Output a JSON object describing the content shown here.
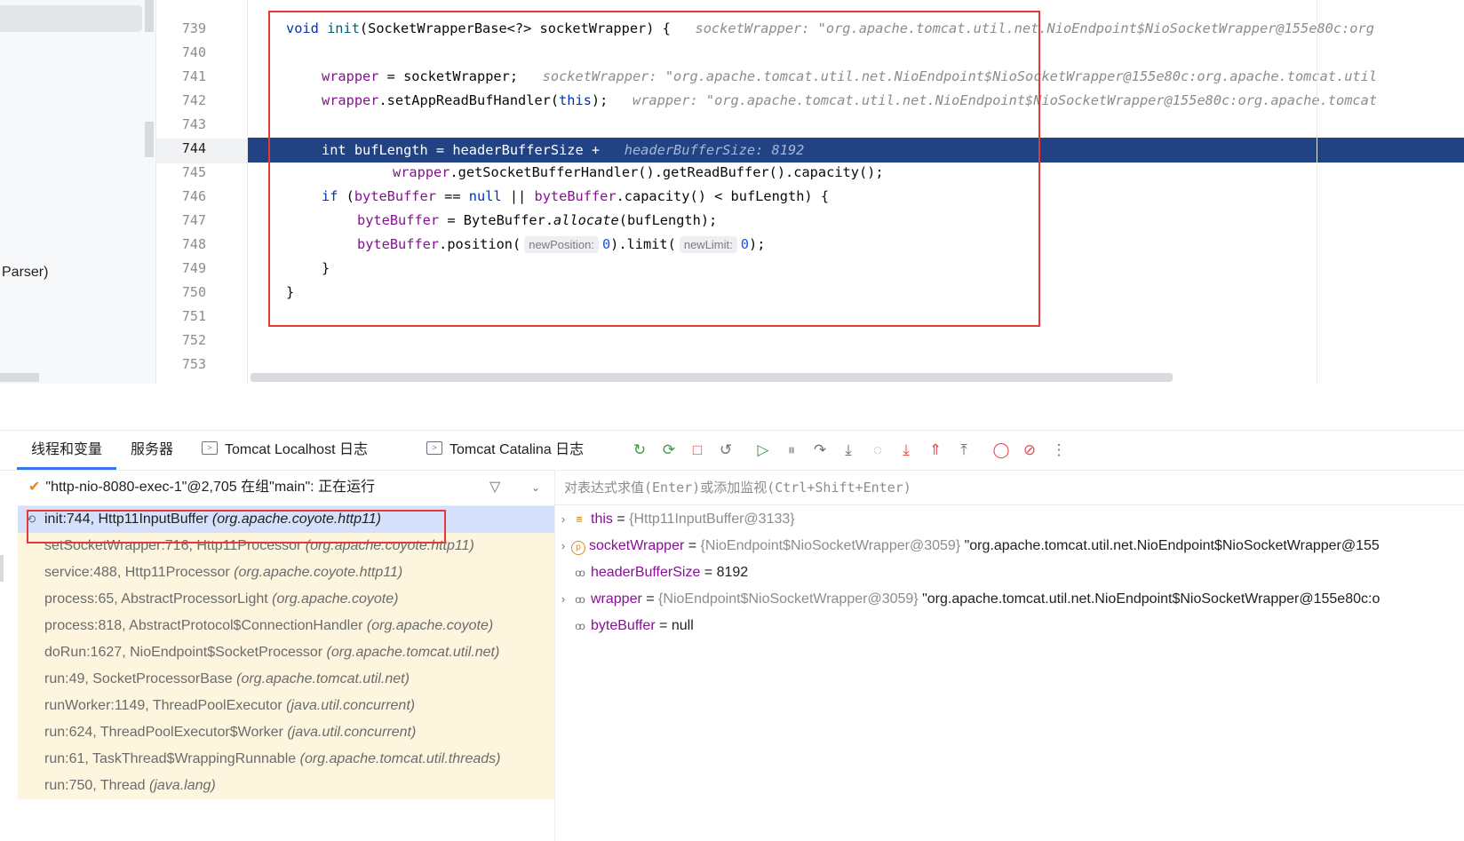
{
  "editor": {
    "left_panel_text": "Parser)",
    "line_numbers": [
      "739",
      "740",
      "741",
      "742",
      "743",
      "744",
      "745",
      "746",
      "747",
      "748",
      "749",
      "750",
      "751",
      "752",
      "753"
    ],
    "current_line": "744",
    "code": {
      "l739": {
        "kw": "void",
        "name": "init",
        "sig": "(SocketWrapperBase<?> socketWrapper) {",
        "hint": "socketWrapper: \"org.apache.tomcat.util.net.NioEndpoint$NioSocketWrapper@155e80c:org"
      },
      "l741": {
        "field": "wrapper",
        "rest": " = socketWrapper;",
        "hint": "socketWrapper: \"org.apache.tomcat.util.net.NioEndpoint$NioSocketWrapper@155e80c:org.apache.tomcat.util"
      },
      "l742": {
        "field": "wrapper",
        "mid": ".setAppReadBufHandler(",
        "kw": "this",
        "end": ");",
        "hint": "wrapper: \"org.apache.tomcat.util.net.NioEndpoint$NioSocketWrapper@155e80c:org.apache.tomcat"
      },
      "l744": {
        "text": "int bufLength = headerBufferSize +",
        "hint": "headerBufferSize: 8192"
      },
      "l745": {
        "field": "wrapper",
        "rest": ".getSocketBufferHandler().getReadBuffer().capacity();"
      },
      "l746": {
        "kw": "if",
        "p1": " (",
        "f1": "byteBuffer",
        "p2": " == ",
        "kw2": "null",
        "p3": " || ",
        "f2": "byteBuffer",
        "p4": ".capacity() < bufLength) {"
      },
      "l747": {
        "field": "byteBuffer",
        "p1": " = ByteBuffer.",
        "method": "allocate",
        "p2": "(bufLength);"
      },
      "l748": {
        "field": "byteBuffer",
        "p1": ".position(",
        "hint1": "newPosition:",
        "n1": "0",
        "p2": ").limit(",
        "hint2": "newLimit:",
        "n2": "0",
        "p3": ");"
      },
      "l749": "}",
      "l750": "}"
    }
  },
  "debug": {
    "tabs": [
      "线程和变量",
      "服务器",
      "Tomcat Localhost 日志",
      "Tomcat Catalina 日志"
    ],
    "thread_label": "\"http-nio-8080-exec-1\"@2,705 在组\"main\": 正在运行",
    "eval_placeholder": "对表达式求值(Enter)或添加监视(Ctrl+Shift+Enter)",
    "frames": [
      {
        "method": "init:744, Http11InputBuffer",
        "pkg": "(org.apache.coyote.http11)"
      },
      {
        "method": "setSocketWrapper:716, Http11Processor",
        "pkg": "(org.apache.coyote.http11)"
      },
      {
        "method": "service:488, Http11Processor",
        "pkg": "(org.apache.coyote.http11)"
      },
      {
        "method": "process:65, AbstractProcessorLight",
        "pkg": "(org.apache.coyote)"
      },
      {
        "method": "process:818, AbstractProtocol$ConnectionHandler",
        "pkg": "(org.apache.coyote)"
      },
      {
        "method": "doRun:1627, NioEndpoint$SocketProcessor",
        "pkg": "(org.apache.tomcat.util.net)"
      },
      {
        "method": "run:49, SocketProcessorBase",
        "pkg": "(org.apache.tomcat.util.net)"
      },
      {
        "method": "runWorker:1149, ThreadPoolExecutor",
        "pkg": "(java.util.concurrent)"
      },
      {
        "method": "run:624, ThreadPoolExecutor$Worker",
        "pkg": "(java.util.concurrent)"
      },
      {
        "method": "run:61, TaskThread$WrappingRunnable",
        "pkg": "(org.apache.tomcat.util.threads)"
      },
      {
        "method": "run:750, Thread",
        "pkg": "(java.lang)"
      }
    ],
    "variables": [
      {
        "name": "this",
        "eq": " = ",
        "type": "{Http11InputBuffer@3133}",
        "value": ""
      },
      {
        "name": "socketWrapper",
        "eq": " = ",
        "type": "{NioEndpoint$NioSocketWrapper@3059}",
        "value": " \"org.apache.tomcat.util.net.NioEndpoint$NioSocketWrapper@155"
      },
      {
        "name": "headerBufferSize",
        "eq": " = ",
        "type": "",
        "value": "8192"
      },
      {
        "name": "wrapper",
        "eq": " = ",
        "type": "{NioEndpoint$NioSocketWrapper@3059}",
        "value": " \"org.apache.tomcat.util.net.NioEndpoint$NioSocketWrapper@155e80c:o"
      },
      {
        "name": "byteBuffer",
        "eq": " = ",
        "type": "",
        "value": "null"
      }
    ]
  },
  "colors": {
    "accent": "#3574f0",
    "highlight_line": "#214283",
    "frames_bg": "#fdf5dd",
    "selected_frame": "#d5e1fb",
    "annotation_red": "#e53935"
  }
}
